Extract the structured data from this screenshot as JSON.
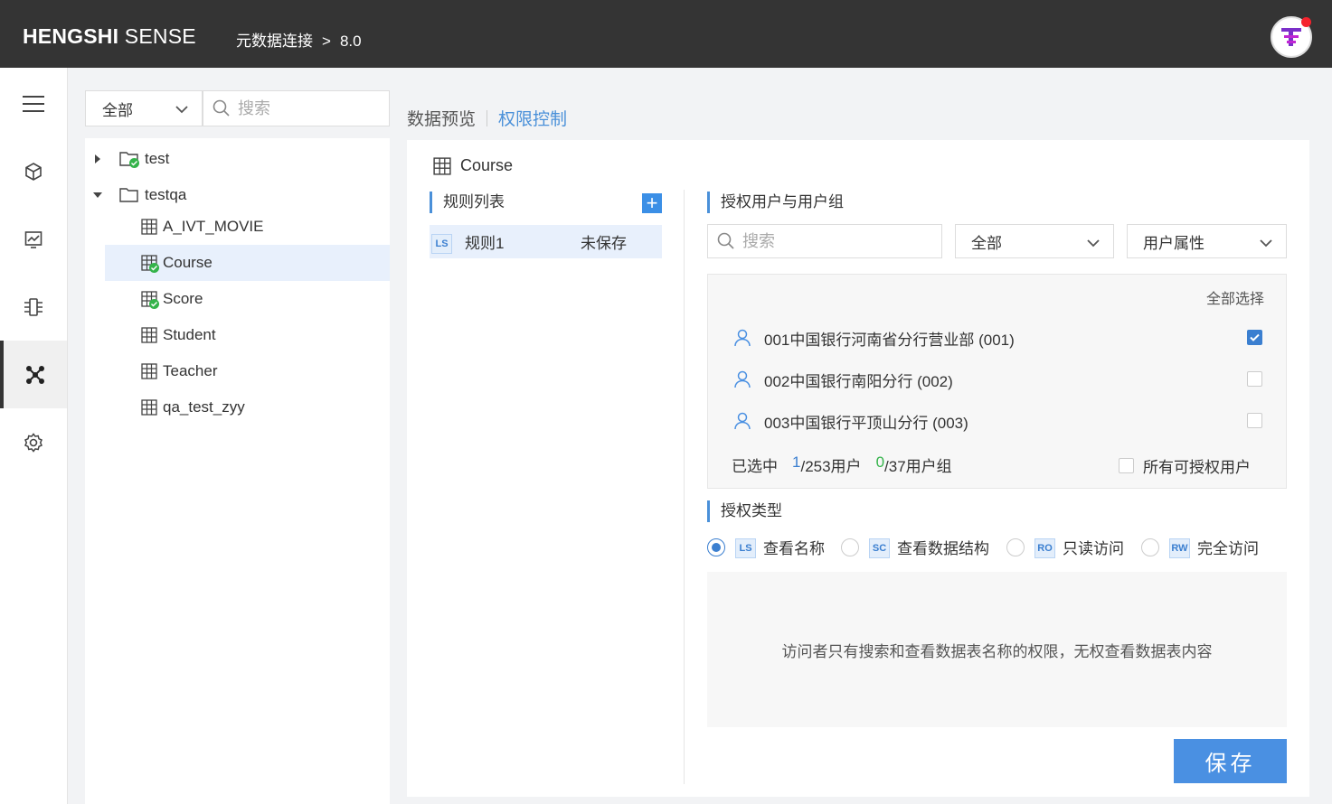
{
  "header": {
    "logo_bold": "HENGSHI",
    "logo_rest": "SENSE",
    "breadcrumb_parent": "元数据连接",
    "breadcrumb_separator": ">",
    "breadcrumb_current": "8.0"
  },
  "rail": {
    "items": [
      "menu-icon",
      "cube-icon",
      "chart-icon",
      "pipeline-icon",
      "data-connection-icon",
      "settings-icon"
    ],
    "active_index": 4
  },
  "tree_panel": {
    "filter_value": "全部",
    "search_placeholder": "搜索",
    "nodes": [
      {
        "label": "test",
        "type": "folder",
        "expanded": false,
        "authorized": true
      },
      {
        "label": "testqa",
        "type": "folder",
        "expanded": true,
        "authorized": false
      },
      {
        "label": "A_IVT_MOVIE",
        "type": "table",
        "authorized": false
      },
      {
        "label": "Course",
        "type": "table",
        "authorized": true,
        "selected": true
      },
      {
        "label": "Score",
        "type": "table",
        "authorized": true
      },
      {
        "label": "Student",
        "type": "table",
        "authorized": false
      },
      {
        "label": "Teacher",
        "type": "table",
        "authorized": false
      },
      {
        "label": "qa_test_zyy",
        "type": "table",
        "authorized": false
      }
    ]
  },
  "main": {
    "tabs": [
      {
        "label": "数据预览",
        "active": false
      },
      {
        "label": "权限控制",
        "active": true
      }
    ],
    "table_name": "Course",
    "rules": {
      "heading": "规则列表",
      "items": [
        {
          "badge": "LS",
          "name": "规则1",
          "status": "未保存"
        }
      ]
    },
    "users": {
      "heading": "授权用户与用户组",
      "search_placeholder": "搜索",
      "scope_filter": "全部",
      "attribute_filter": "用户属性",
      "select_all": "全部选择",
      "list": [
        {
          "name": "001中国银行河南省分行营业部 (001)",
          "checked": true
        },
        {
          "name": "002中国银行南阳分行 (002)",
          "checked": false
        },
        {
          "name": "003中国银行平顶山分行 (003)",
          "checked": false
        }
      ],
      "selected_label": "已选中",
      "selected_users_count": "1",
      "users_total_text": "/253用户",
      "selected_groups_count": "0",
      "groups_total_text": "/37用户组",
      "all_authorizable_label": "所有可授权用户",
      "all_authorizable_checked": false
    },
    "auth_type": {
      "heading": "授权类型",
      "options": [
        {
          "badge": "LS",
          "label": "查看名称",
          "selected": true
        },
        {
          "badge": "SC",
          "label": "查看数据结构",
          "selected": false
        },
        {
          "badge": "RO",
          "label": "只读访问",
          "selected": false
        },
        {
          "badge": "RW",
          "label": "完全访问",
          "selected": false
        }
      ],
      "description": "访问者只有搜索和查看数据表名称的权限，无权查看数据表内容"
    },
    "save_label": "保存"
  },
  "colors": {
    "header_bg": "#343434",
    "accent": "#4a90e2",
    "selected_row_bg": "#e8f0fc",
    "authorized_badge": "#34b34a"
  }
}
